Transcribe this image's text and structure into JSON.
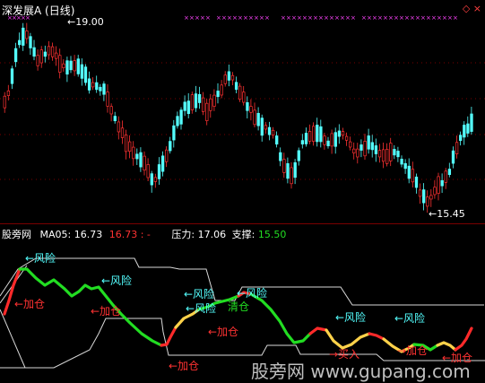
{
  "title": "深发展A (日线)",
  "window_controls": "◇ ×",
  "price_panel": {
    "high_label": "19.00",
    "low_label": "15.45"
  },
  "indicator_bar": {
    "name": "股旁网",
    "ma05_label": "MA05:",
    "ma05_value": "16.73",
    "ma05_value2": "16.73",
    "sep": ": -",
    "pressure_label": "压力:",
    "pressure_value": "17.06",
    "support_label": "支撑:",
    "support_value": "15.50"
  },
  "annotations": [
    {
      "text": "←风险",
      "kind": "risk"
    },
    {
      "text": "←风险",
      "kind": "risk"
    },
    {
      "text": "←风险",
      "kind": "risk"
    },
    {
      "text": "←风险",
      "kind": "risk"
    },
    {
      "text": "←风险",
      "kind": "risk"
    },
    {
      "text": "←风险",
      "kind": "risk"
    },
    {
      "text": "←风险",
      "kind": "risk"
    },
    {
      "text": "←加仓",
      "kind": "add"
    },
    {
      "text": "←加仓",
      "kind": "add"
    },
    {
      "text": "←加仓",
      "kind": "add"
    },
    {
      "text": "←加仓",
      "kind": "add"
    },
    {
      "text": "清仓",
      "kind": "clear"
    },
    {
      "text": "→买入",
      "kind": "buy"
    },
    {
      "text": "→加仓",
      "kind": "add"
    },
    {
      "text": "←加仓",
      "kind": "add"
    }
  ],
  "watermark": "股旁网  www.gupang.com",
  "colors": {
    "up": "#ff3232",
    "down": "#54ffff",
    "risk": "#54ffff",
    "add": "#ff3232",
    "line_green": "#22dd22",
    "line_red": "#ff2a2a",
    "line_yellow": "#ffd24a",
    "channel": "#d8d8d8",
    "magenta": "#ff44ff"
  }
}
